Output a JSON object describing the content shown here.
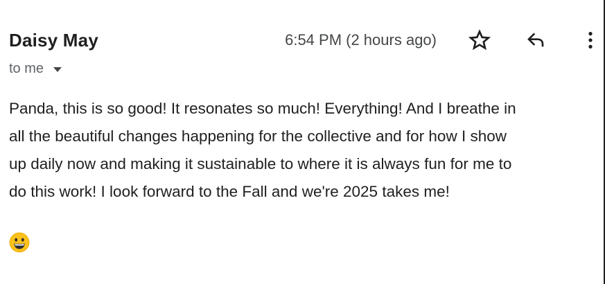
{
  "email": {
    "sender_name": "Daisy May",
    "recipient_text": "to me",
    "timestamp": "6:54 PM (2 hours ago)",
    "body_lines": [
      "Panda, this is so good! It resonates so much! Everything! And I breathe in",
      "all the beautiful changes happening for the collective and for how I show",
      "up daily now and making it sustainable to where it is always fun for me to",
      "do this work! I look forward to the Fall and we're 2025 takes me!"
    ],
    "signoff_emoji": "grinning-face-emoji"
  },
  "icons": {
    "star": "star-icon",
    "reply": "reply-icon",
    "more": "more-vert-icon",
    "recipients_toggle": "chevron-down-icon"
  },
  "colors": {
    "text_primary": "#1f1f1f",
    "text_secondary": "#5f6368",
    "icon": "#444746",
    "emoji_face": "#fcc21b"
  }
}
